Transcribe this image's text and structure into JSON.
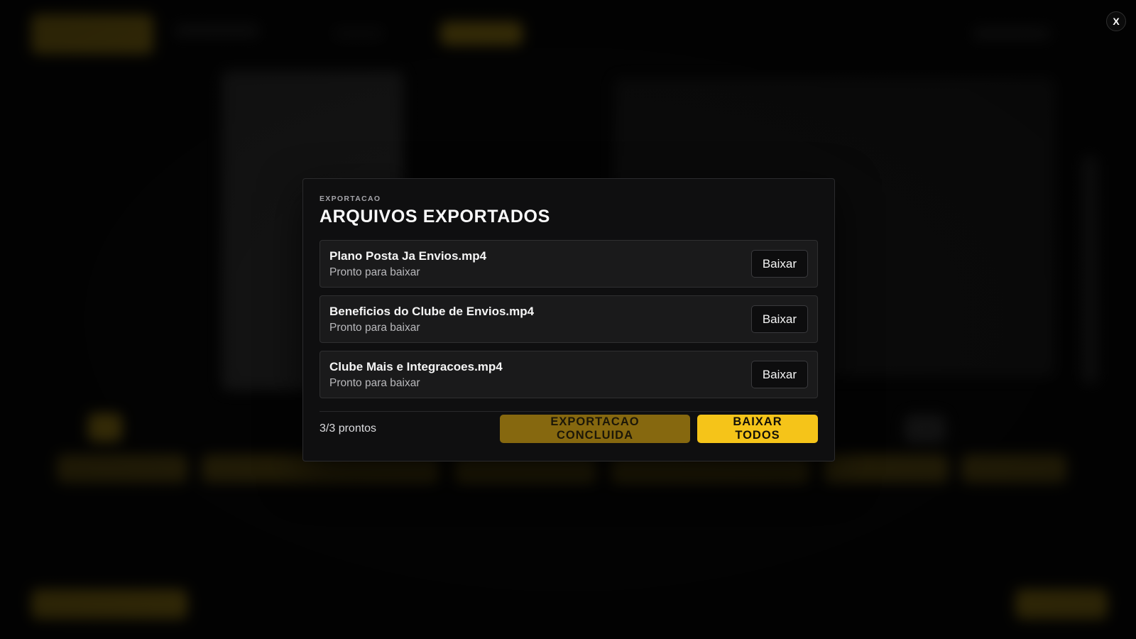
{
  "close_button": {
    "label": "X"
  },
  "modal": {
    "eyebrow": "EXPORTACAO",
    "title": "ARQUIVOS EXPORTADOS",
    "files": [
      {
        "name": "Plano Posta Ja Envios.mp4",
        "status": "Pronto para baixar",
        "action": "Baixar"
      },
      {
        "name": "Beneficios do Clube de Envios.mp4",
        "status": "Pronto para baixar",
        "action": "Baixar"
      },
      {
        "name": "Clube Mais e Integracoes.mp4",
        "status": "Pronto para baixar",
        "action": "Baixar"
      }
    ],
    "footer": {
      "count": "3/3 prontos",
      "done_label": "EXPORTACAO CONCLUIDA",
      "download_all_label": "BAIXAR TODOS"
    }
  },
  "colors": {
    "accent": "#f5c419",
    "accent_muted": "#86680f",
    "modal_bg": "#0f0f10",
    "row_bg": "#1a1a1b"
  }
}
